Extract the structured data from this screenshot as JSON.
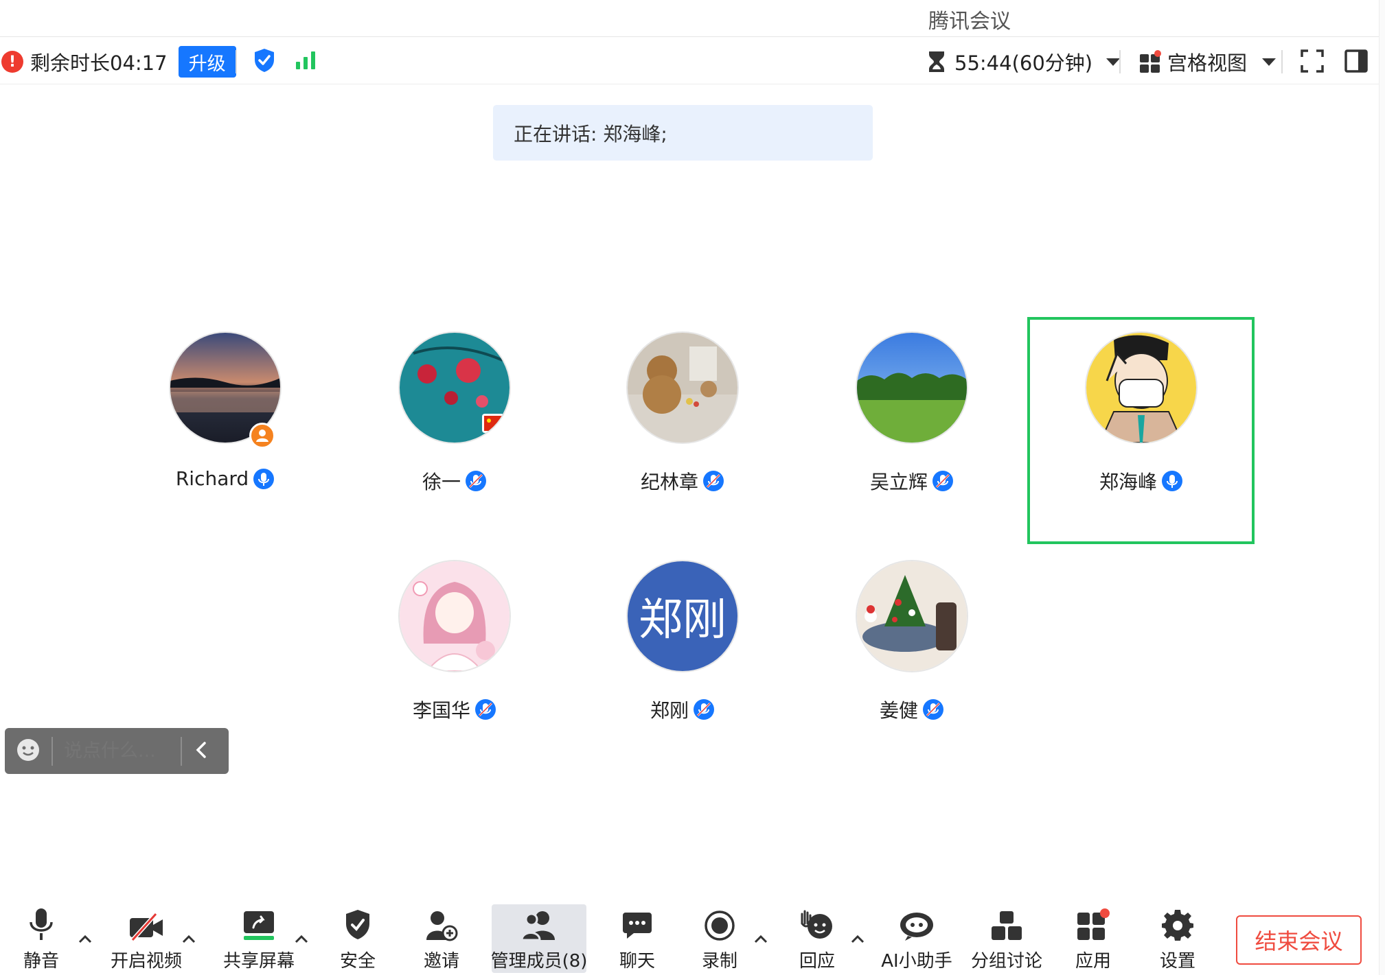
{
  "app": {
    "title": "腾讯会议"
  },
  "toolbar": {
    "remaining_text": "剩余时长04:17",
    "upgrade_label": "升级",
    "timer_text": "55:44(60分钟)",
    "view_label": "宫格视图"
  },
  "banner": {
    "speaking_text": "正在讲话: 郑海峰;"
  },
  "participants": [
    {
      "name": "Richard",
      "avatar": "sunset-lake",
      "mic": "active",
      "badge": "host"
    },
    {
      "name": "徐一",
      "avatar": "red-flowers-teal",
      "mic": "muted",
      "badge": "flag"
    },
    {
      "name": "纪林章",
      "avatar": "teddy-bears",
      "mic": "muted"
    },
    {
      "name": "吴立辉",
      "avatar": "green-park",
      "mic": "muted"
    },
    {
      "name": "郑海峰",
      "avatar": "cartoon-masked-man",
      "mic": "active",
      "speaking": true
    },
    {
      "name": "李国华",
      "avatar": "pink-anime-girl",
      "mic": "muted"
    },
    {
      "name": "郑刚",
      "avatar_text": "郑刚",
      "mic": "muted"
    },
    {
      "name": "姜健",
      "avatar": "christmas-cake",
      "mic": "muted"
    }
  ],
  "chat": {
    "placeholder": "说点什么..."
  },
  "bottom_bar": {
    "mute": "静音",
    "video": "开启视频",
    "share": "共享屏幕",
    "security": "安全",
    "invite": "邀请",
    "members": "管理成员(8)",
    "chat": "聊天",
    "record": "录制",
    "react": "回应",
    "ai": "AI小助手",
    "breakout": "分组讨论",
    "apps": "应用",
    "settings": "设置",
    "end": "结束会议"
  },
  "colors": {
    "accent": "#1677ff",
    "speaking_border": "#22c55e",
    "end": "#ef4b3f",
    "signal": "#22c55e"
  }
}
